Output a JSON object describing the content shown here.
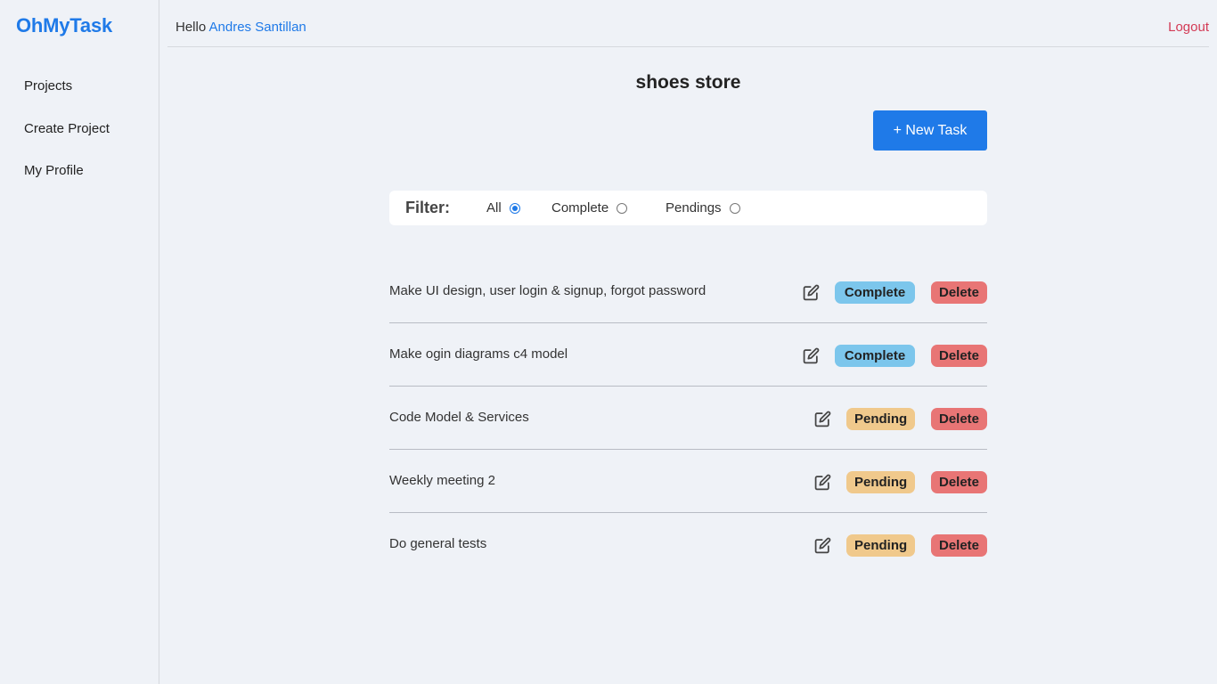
{
  "app": {
    "brand": "OhMyTask"
  },
  "sidebar": {
    "items": [
      {
        "label": "Projects"
      },
      {
        "label": "Create Project"
      },
      {
        "label": "My Profile"
      }
    ]
  },
  "header": {
    "greeting": "Hello",
    "username": "Andres Santillan",
    "logout": "Logout"
  },
  "project": {
    "title": "shoes store",
    "new_task_label": "+ New Task"
  },
  "filter": {
    "label": "Filter:",
    "options": [
      {
        "label": "All",
        "checked": true
      },
      {
        "label": "Complete",
        "checked": false
      },
      {
        "label": "Pendings",
        "checked": false
      }
    ]
  },
  "tasks": [
    {
      "title": "Make UI design, user login & signup, forgot password",
      "status": "Complete",
      "delete": "Delete"
    },
    {
      "title": "Make ogin diagrams c4 model",
      "status": "Complete",
      "delete": "Delete"
    },
    {
      "title": "Code Model & Services",
      "status": "Pending",
      "delete": "Delete"
    },
    {
      "title": "Weekly meeting 2",
      "status": "Pending",
      "delete": "Delete"
    },
    {
      "title": "Do general tests",
      "status": "Pending",
      "delete": "Delete"
    }
  ],
  "icons": {
    "edit": "edit-icon"
  },
  "colors": {
    "accent": "#1f7ae8",
    "logout": "#d33a55",
    "complete": "#7cc6ec",
    "pending": "#f0c98c",
    "delete": "#e87575",
    "background": "#eff2f7"
  }
}
